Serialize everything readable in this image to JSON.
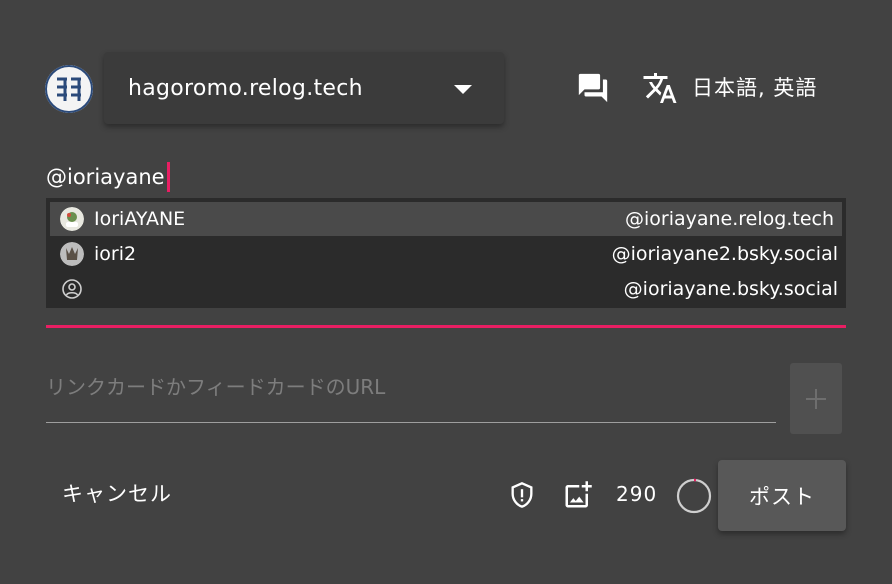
{
  "account": {
    "avatar_icon": "user-avatar-logo",
    "server": "hagoromo.relog.tech"
  },
  "toolbar": {
    "thread_icon": "forum-icon",
    "translate_icon": "translate-icon",
    "language_label": "日本語, 英語"
  },
  "editor": {
    "text": "@ioriayane",
    "cursor_color": "#e91e63"
  },
  "suggestions": [
    {
      "name": "IoriAYANE",
      "handle": "@ioriayane.relog.tech",
      "selected": true
    },
    {
      "name": "iori2",
      "handle": "@ioriayane2.bsky.social",
      "selected": false
    },
    {
      "name": "",
      "handle": "@ioriayane.bsky.social",
      "selected": false
    }
  ],
  "link_card": {
    "placeholder": "リンクカードかフィードカードのURL",
    "value": ""
  },
  "footer": {
    "cancel_label": "キャンセル",
    "remaining_chars": "290",
    "post_label": "ポスト",
    "accent_color": "#e91e63"
  }
}
